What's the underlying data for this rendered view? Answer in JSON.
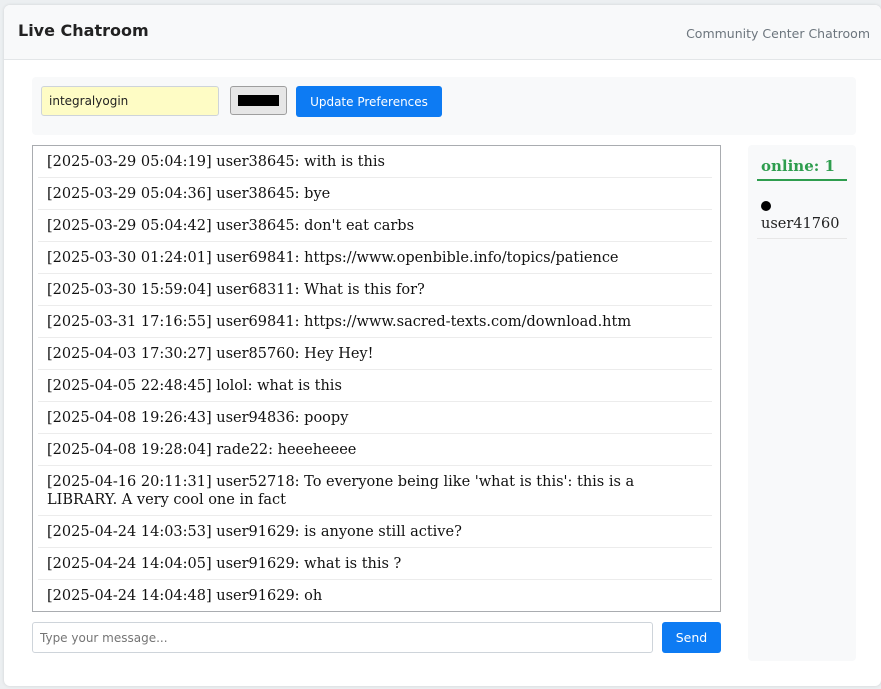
{
  "header": {
    "title": "Live Chatroom",
    "subtitle": "Community Center Chatroom"
  },
  "preferences": {
    "username": "integralyogin",
    "color": "#000000",
    "update_label": "Update Preferences"
  },
  "messages": [
    {
      "text": "[2025-03-29 05:04:19] user38645: with is this"
    },
    {
      "text": "[2025-03-29 05:04:36] user38645: bye"
    },
    {
      "text": "[2025-03-29 05:04:42] user38645: don't eat carbs"
    },
    {
      "text": "[2025-03-30 01:24:01] user69841: https://www.openbible.info/topics/patience"
    },
    {
      "text": "[2025-03-30 15:59:04] user68311: What is this for?"
    },
    {
      "text": "[2025-03-31 17:16:55] user69841: https://www.sacred-texts.com/download.htm"
    },
    {
      "text": "[2025-04-03 17:30:27] user85760: Hey Hey!"
    },
    {
      "text": "[2025-04-05 22:48:45] lolol: what is this"
    },
    {
      "text": "[2025-04-08 19:26:43] user94836: poopy"
    },
    {
      "text": "[2025-04-08 19:28:04] rade22: heeeheeee"
    },
    {
      "text": "[2025-04-16 20:11:31] user52718: To everyone being like 'what is this': this is a LIBRARY. A very cool one in fact"
    },
    {
      "text": "[2025-04-24 14:03:53] user91629: is anyone still active?"
    },
    {
      "text": "[2025-04-24 14:04:05] user91629: what is this ?"
    },
    {
      "text": "[2025-04-24 14:04:48] user91629: oh"
    }
  ],
  "compose": {
    "placeholder": "Type your message...",
    "send_label": "Send"
  },
  "online": {
    "title": "online: 1",
    "users": [
      {
        "name": "user41760",
        "dot_color": "#000000"
      }
    ]
  }
}
